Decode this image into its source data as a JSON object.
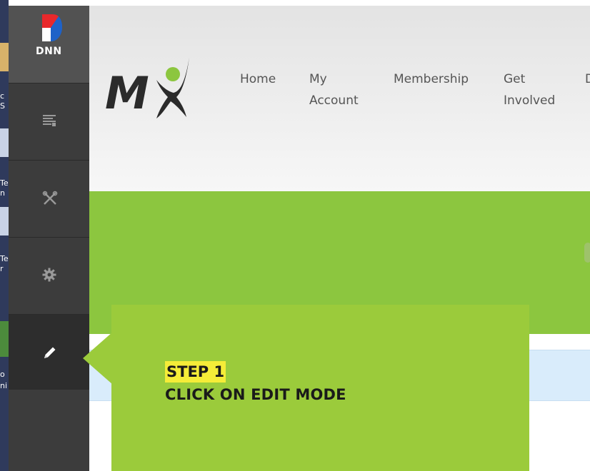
{
  "desktop_strip": {
    "fragments": [
      "c",
      "S",
      "Te",
      "n",
      "Te",
      "r",
      "o",
      "ni"
    ]
  },
  "persona_bar": {
    "logo_text": "DNN",
    "items": [
      {
        "icon": "content-icon"
      },
      {
        "icon": "tools-icon"
      },
      {
        "icon": "settings-gear-icon"
      },
      {
        "icon": "edit-pencil-icon"
      }
    ]
  },
  "site": {
    "logo_text": "MX",
    "nav": [
      {
        "label": "Home"
      },
      {
        "label": "My\nAccount"
      },
      {
        "label": "Membership"
      },
      {
        "label": "Get\nInvolved"
      },
      {
        "label": "D"
      }
    ]
  },
  "callout": {
    "step": "STEP 1",
    "instruction": "CLICK ON EDIT MODE"
  },
  "colors": {
    "persona_bg": "#3c3c3c",
    "banner_green": "#8cc63f",
    "callout_green": "#9bcb3b",
    "highlight_yellow": "#f5ec38",
    "info_blue": "#d9ecfb"
  }
}
